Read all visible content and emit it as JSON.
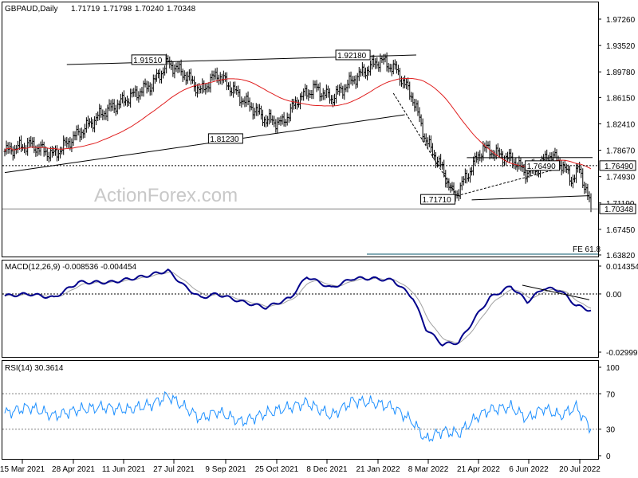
{
  "chart_data": [
    {
      "type": "candlestick",
      "symbol_title": "GBPAUD,Daily",
      "ohlc": [
        "1.71719",
        "1.71798",
        "1.70240",
        "1.70348"
      ],
      "y_ticks": [
        "1.97260",
        "1.93520",
        "1.89780",
        "1.86150",
        "1.82410",
        "1.78670",
        "1.74930",
        "1.71190",
        "1.67450",
        "1.63820"
      ],
      "ylim": [
        1.6382,
        1.9726
      ],
      "current_price": "1.70348",
      "watermark": "ActionForex.com",
      "fe_label": "FE 61.8",
      "level_labels": [
        {
          "label": "1.91510",
          "value": 1.9151
        },
        {
          "label": "1.92180",
          "value": 1.9218
        },
        {
          "label": "1.81230",
          "value": 1.8123
        },
        {
          "label": "1.71710",
          "value": 1.7171
        },
        {
          "label": "1.76490",
          "value": 1.7649
        }
      ],
      "right_labels": [
        "1.76490",
        "1.70348"
      ],
      "series": [
        {
          "name": "price",
          "color": "#000000"
        },
        {
          "name": "moving average",
          "color": "#e02020"
        }
      ]
    },
    {
      "type": "line",
      "title": "MACD(12,26,9) -0.008536 -0.004454",
      "y_ticks": [
        "0.014354",
        "0.00",
        "-0.029999"
      ],
      "ylim": [
        -0.03,
        0.014354
      ],
      "series": [
        {
          "name": "macd",
          "color": "#00008b"
        },
        {
          "name": "signal",
          "color": "#a0a0a0"
        }
      ]
    },
    {
      "type": "line",
      "title": "RSI(14) 30.3614",
      "y_ticks": [
        "100",
        "70",
        "30",
        "0"
      ],
      "ylim": [
        0,
        100
      ],
      "levels": [
        70,
        30
      ],
      "series": [
        {
          "name": "rsi",
          "color": "#1e90ff"
        }
      ]
    }
  ],
  "x_labels": [
    "15 Mar 2021",
    "28 Apr 2021",
    "11 Jun 2021",
    "27 Jul 2021",
    "9 Sep 2021",
    "25 Oct 2021",
    "8 Dec 2021",
    "21 Jan 2022",
    "8 Mar 2022",
    "21 Apr 2022",
    "6 Jun 2022",
    "20 Jul 2022"
  ]
}
